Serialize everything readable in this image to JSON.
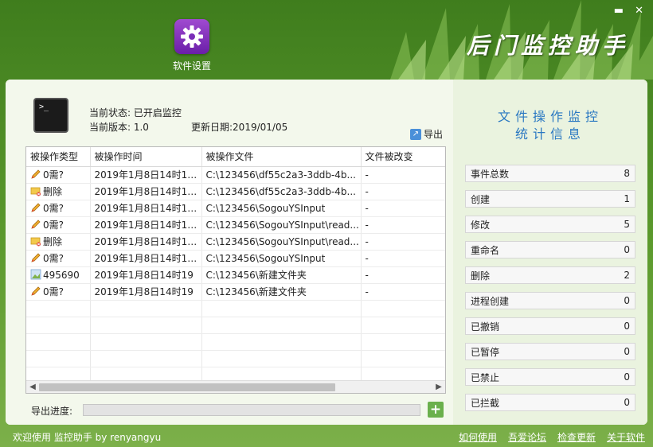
{
  "window": {
    "minimize": "▬",
    "close": "✕"
  },
  "header": {
    "settings_label": "软件设置",
    "brand": "后门监控助手"
  },
  "status": {
    "state": "当前状态: 已开启监控",
    "version": "当前版本: 1.0",
    "update_date": "更新日期:2019/01/05",
    "export_label": "导出"
  },
  "table": {
    "columns": [
      "被操作类型",
      "被操作时间",
      "被操作文件",
      "文件被改变"
    ],
    "rows": [
      {
        "icon": "pencil-icon",
        "type": "0需?",
        "time": "2019年1月8日14时18...",
        "file": "C:\\123456\\df55c2a3-3ddb-4b...",
        "changed": "-"
      },
      {
        "icon": "delete-folder-icon",
        "type": "删除",
        "time": "2019年1月8日14时18...",
        "file": "C:\\123456\\df55c2a3-3ddb-4b...",
        "changed": "-"
      },
      {
        "icon": "pencil-icon",
        "type": "0需?",
        "time": "2019年1月8日14时18...",
        "file": "C:\\123456\\SogouYSInput",
        "changed": "-"
      },
      {
        "icon": "pencil-icon",
        "type": "0需?",
        "time": "2019年1月8日14时18...",
        "file": "C:\\123456\\SogouYSInput\\read...",
        "changed": "-"
      },
      {
        "icon": "delete-folder-icon",
        "type": "删除",
        "time": "2019年1月8日14时18...",
        "file": "C:\\123456\\SogouYSInput\\read...",
        "changed": "-"
      },
      {
        "icon": "pencil-icon",
        "type": "0需?",
        "time": "2019年1月8日14时18...",
        "file": "C:\\123456\\SogouYSInput",
        "changed": "-"
      },
      {
        "icon": "image-file-icon",
        "type": "495690",
        "time": "2019年1月8日14时19",
        "file": "C:\\123456\\新建文件夹",
        "changed": "-"
      },
      {
        "icon": "pencil-icon",
        "type": "0需?",
        "time": "2019年1月8日14时19",
        "file": "C:\\123456\\新建文件夹",
        "changed": "-"
      }
    ],
    "empty_rows": 6
  },
  "progress": {
    "label": "导出进度:",
    "value": 0
  },
  "stats": {
    "title_line1": "文件操作监控",
    "title_line2": "统计信息",
    "items": [
      {
        "label": "事件总数",
        "value": "8"
      },
      {
        "label": "创建",
        "value": "1"
      },
      {
        "label": "修改",
        "value": "5"
      },
      {
        "label": "重命名",
        "value": "0"
      },
      {
        "label": "删除",
        "value": "2"
      },
      {
        "label": "进程创建",
        "value": "0"
      },
      {
        "label": "已撤销",
        "value": "0"
      },
      {
        "label": "已暂停",
        "value": "0"
      },
      {
        "label": "已禁止",
        "value": "0"
      },
      {
        "label": "已拦截",
        "value": "0"
      }
    ]
  },
  "footer": {
    "welcome": "欢迎使用 监控助手  by  renyangyu",
    "links": [
      "如何使用",
      "吾爱论坛",
      "检查更新",
      "关于软件"
    ]
  }
}
